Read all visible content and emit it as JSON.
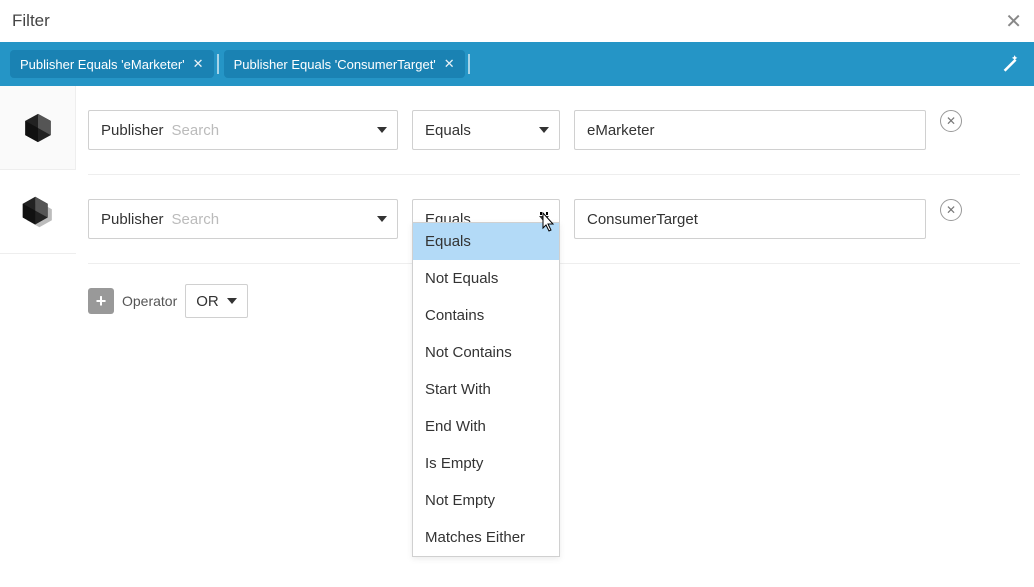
{
  "header": {
    "title": "Filter"
  },
  "chips": [
    {
      "label": "Publisher Equals 'eMarketer'"
    },
    {
      "label": "Publisher Equals 'ConsumerTarget'"
    }
  ],
  "rows": [
    {
      "field_label": "Publisher",
      "search_placeholder": "Search",
      "operator": "Equals",
      "value": "eMarketer"
    },
    {
      "field_label": "Publisher",
      "search_placeholder": "Search",
      "operator": "Equals",
      "value": "ConsumerTarget"
    }
  ],
  "operator_row": {
    "label": "Operator",
    "selected": "OR"
  },
  "dropdown": {
    "open": true,
    "selected": "Equals",
    "options": [
      "Equals",
      "Not Equals",
      "Contains",
      "Not Contains",
      "Start With",
      "End With",
      "Is Empty",
      "Not Empty",
      "Matches Either"
    ]
  }
}
